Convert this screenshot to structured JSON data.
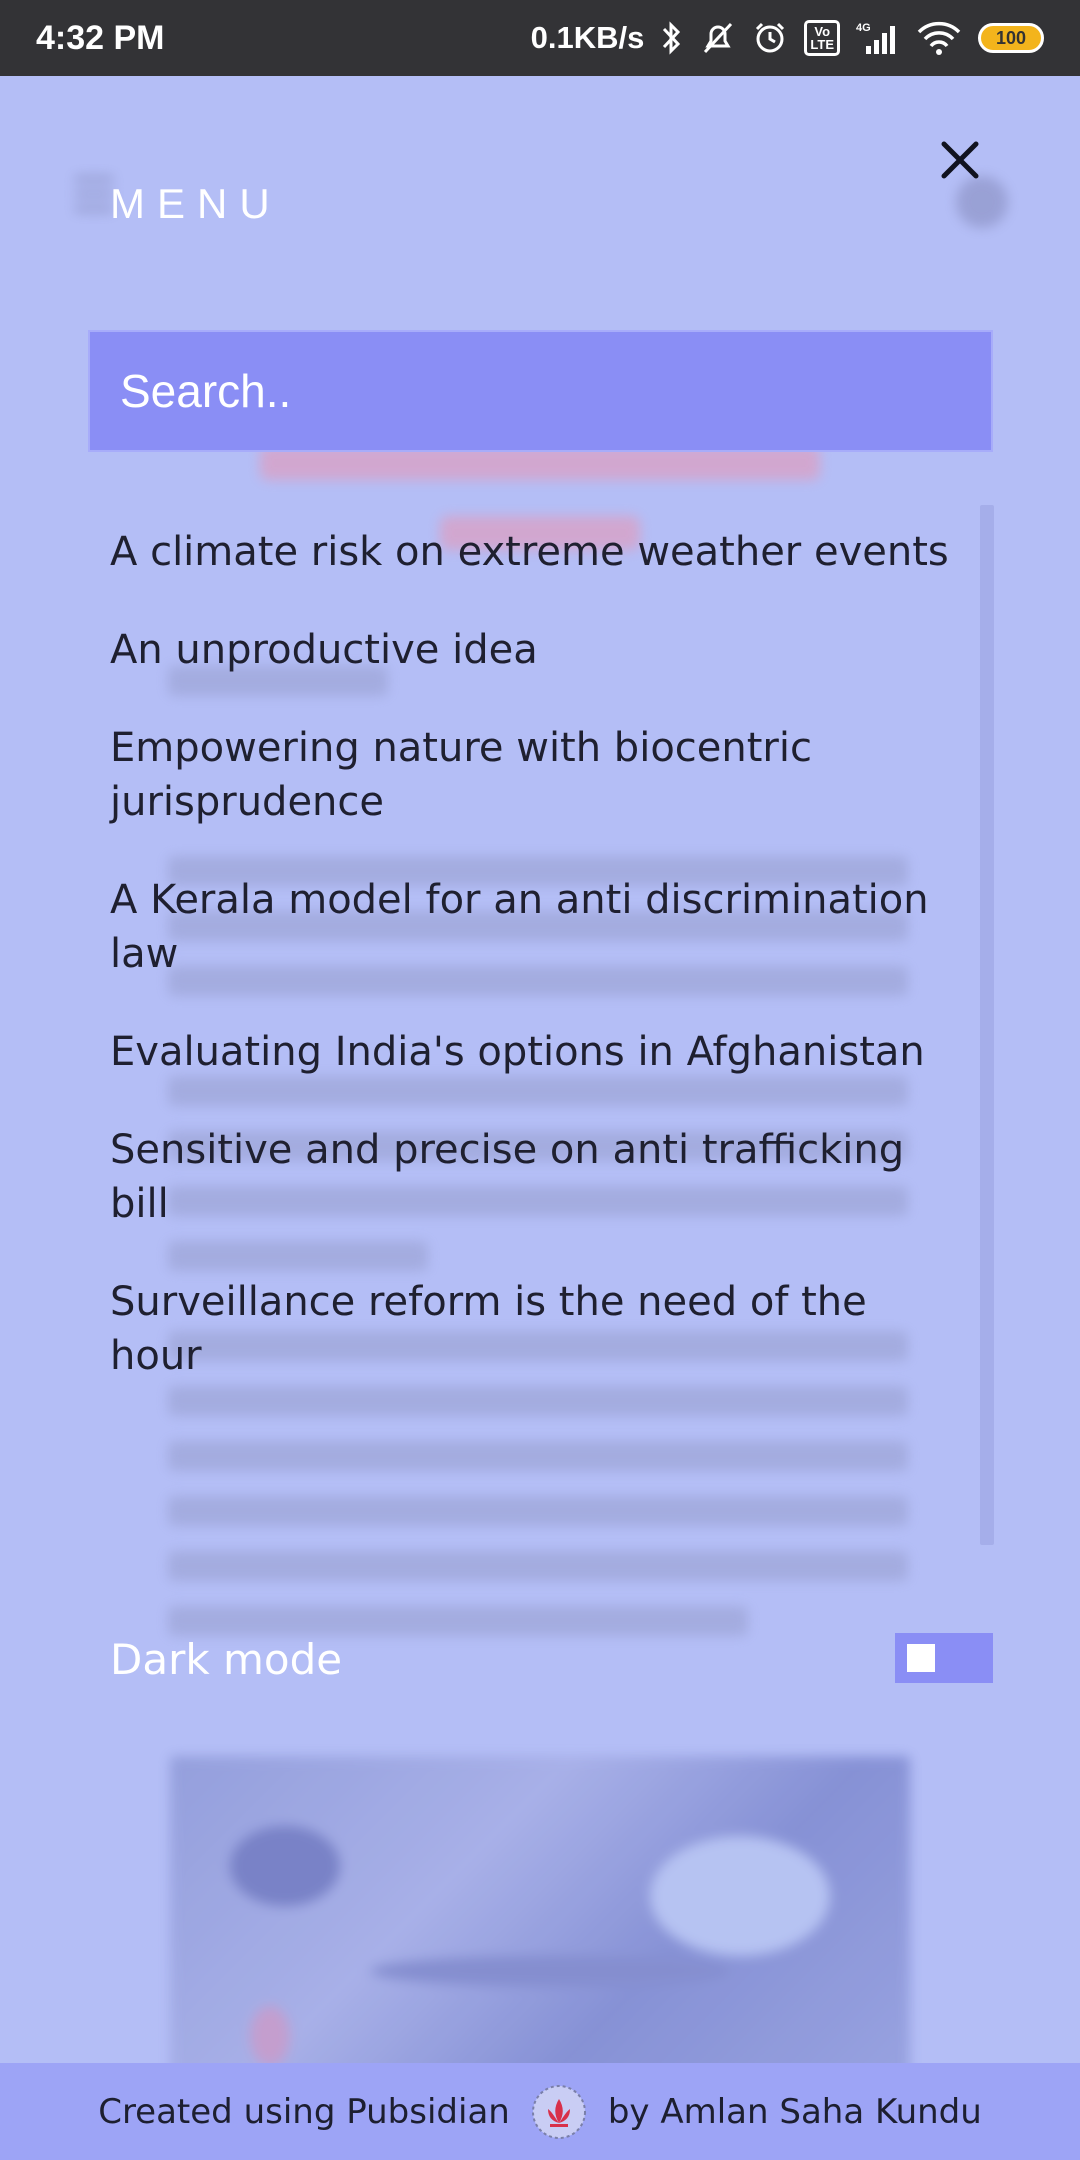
{
  "status_bar": {
    "time": "4:32 PM",
    "network_speed": "0.1KB/s",
    "volte_label": "Vo\nLTE",
    "network_type": "4G",
    "battery": "100"
  },
  "menu": {
    "title": "MENU",
    "search_placeholder": "Search..",
    "articles": [
      "A climate risk on extreme weather events",
      "An unproductive idea",
      "Empowering nature with biocentric jurisprudence",
      "A Kerala model for an anti discrimination law",
      "Evaluating India's options in Afghanistan",
      "Sensitive and precise on anti trafficking bill",
      "Surveillance reform is the need of the hour"
    ],
    "dark_mode_label": "Dark mode",
    "dark_mode_enabled": false
  },
  "footer": {
    "created_text": "Created using Pubsidian",
    "author_text": "by Amlan Saha Kundu"
  },
  "colors": {
    "overlay_bg": "#b4bef6",
    "accent": "#8a8ef5",
    "status_bar": "#333336"
  },
  "icons": {
    "close": "close-icon",
    "bluetooth": "bluetooth-icon",
    "alarm": "alarm-icon",
    "wifi": "wifi-icon",
    "logo": "pubsidian-logo-icon"
  }
}
